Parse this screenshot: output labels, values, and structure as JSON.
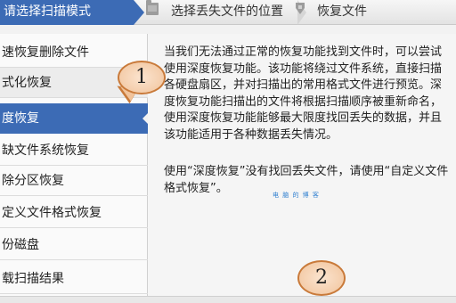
{
  "steps": [
    {
      "label": "请选择扫描模式",
      "active": true
    },
    {
      "label": "选择丢失文件的位置",
      "active": false
    },
    {
      "label": "恢复文件",
      "active": false
    }
  ],
  "sidebar": {
    "items": [
      {
        "label": "速恢复删除文件"
      },
      {
        "label": "式化恢复"
      },
      {
        "label": "度恢复"
      },
      {
        "label": "缺文件系统恢复"
      },
      {
        "label": "除分区恢复"
      },
      {
        "label": "定义文件格式恢复"
      },
      {
        "label": "份磁盘"
      },
      {
        "label": "载扫描结果"
      }
    ]
  },
  "content": {
    "paragraph1": [
      "当我们无法通过正常的恢复功能找到文件时，可以尝试",
      "使用深度恢复功能。该功能将绕过文件系统，直接扫描",
      "各硬盘扇区，并对扫描出的常用格式文件进行预览。深",
      "度恢复功能扫描出的文件将根据扫描顺序被重新命名，",
      "使用深度恢复功能能够最大限度找回丢失的数据，并且",
      "该功能适用于各种数据丢失情况。"
    ],
    "paragraph2": [
      "使用“深度恢复”没有找回丢失文件，请使用“自定义文件",
      "格式恢复”。"
    ],
    "watermark": "电 脑 的 博 客"
  },
  "callouts": {
    "one": "1",
    "two": "2"
  },
  "colors": {
    "accent": "#3c6bb5",
    "callout_border": "#c97a3a",
    "callout_fill": "#f1c39b"
  }
}
